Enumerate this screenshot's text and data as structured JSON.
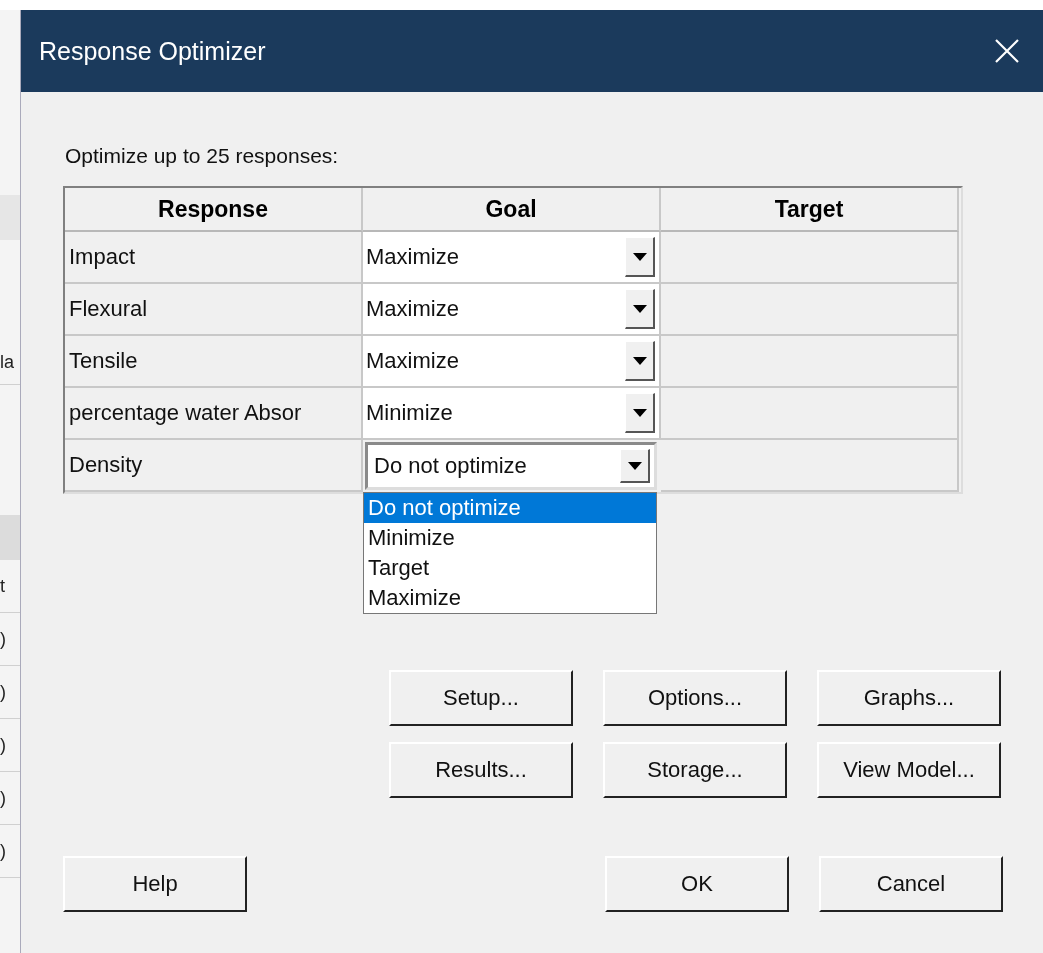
{
  "background_window": {
    "fragments": [
      {
        "text": "la"
      },
      {
        "text": "t"
      },
      {
        "text": ")"
      },
      {
        "text": ")"
      },
      {
        "text": ")"
      },
      {
        "text": ")"
      },
      {
        "text": ")"
      }
    ]
  },
  "dialog": {
    "title": "Response Optimizer",
    "prompt": "Optimize up to 25 responses:",
    "table": {
      "columns": [
        "Response",
        "Goal",
        "Target"
      ],
      "rows": [
        {
          "response": "Impact",
          "goal": "Maximize",
          "open": false
        },
        {
          "response": "Flexural",
          "goal": "Maximize",
          "open": false
        },
        {
          "response": "Tensile",
          "goal": "Maximize",
          "open": false
        },
        {
          "response": "percentage water Absor",
          "goal": "Minimize",
          "open": false
        },
        {
          "response": "Density",
          "goal": "Do not optimize",
          "open": true
        }
      ]
    },
    "dropdown": {
      "options": [
        {
          "label": "Do not optimize",
          "selected": true
        },
        {
          "label": "Minimize",
          "selected": false
        },
        {
          "label": "Target",
          "selected": false
        },
        {
          "label": "Maximize",
          "selected": false
        }
      ]
    },
    "action_buttons": [
      "Setup...",
      "Options...",
      "Graphs...",
      "Results...",
      "Storage...",
      "View Model..."
    ],
    "help_button": "Help",
    "ok_button": "OK",
    "cancel_button": "Cancel"
  }
}
